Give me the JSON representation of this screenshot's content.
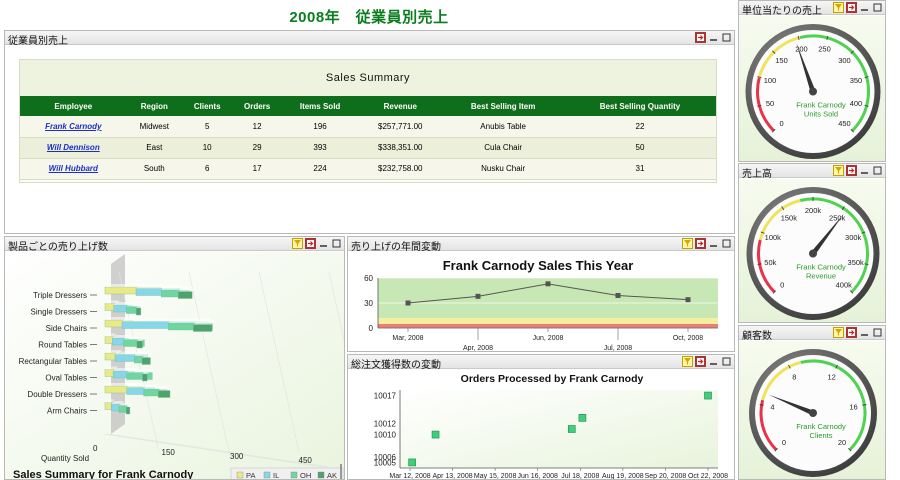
{
  "page": {
    "title": "2008年　従業員別売上"
  },
  "panels": {
    "employee_sales": {
      "title": "従業員別売上"
    },
    "product_sales": {
      "title": "製品ごとの売り上げ数"
    },
    "annual_trend": {
      "title": "売り上げの年間変動"
    },
    "orders_trend": {
      "title": "総注文獲得数の変動"
    },
    "unit_sales": {
      "title": "単位当たりの売上"
    },
    "revenue": {
      "title": "売上高"
    },
    "clients": {
      "title": "顧客数"
    }
  },
  "summary": {
    "caption": "Sales Summary",
    "columns": [
      "Employee",
      "Region",
      "Clients",
      "Orders",
      "Items Sold",
      "Revenue",
      "Best Selling Item",
      "Best Selling Quantity"
    ],
    "rows": [
      [
        "Frank Carnody",
        "Midwest",
        "5",
        "12",
        "196",
        "$257,771.00",
        "Anubis Table",
        "22"
      ],
      [
        "Will Dennison",
        "East",
        "10",
        "29",
        "393",
        "$338,351.00",
        "Cula Chair",
        "50"
      ],
      [
        "Will Hubbard",
        "South",
        "6",
        "17",
        "224",
        "$232,758.00",
        "Nusku Chair",
        "31"
      ]
    ]
  },
  "gauges": {
    "unit_sales": {
      "ticks": [
        "0",
        "50",
        "100",
        "150",
        "200",
        "250",
        "300",
        "350",
        "400",
        "450"
      ],
      "label1": "Frank Carnody",
      "label2": "Units Sold",
      "value_fraction": 0.43
    },
    "revenue": {
      "ticks": [
        "0",
        "50k",
        "100k",
        "150k",
        "200k",
        "250k",
        "300k",
        "350k",
        "400k"
      ],
      "label1": "Frank Carnody",
      "label2": "Revenue",
      "value_fraction": 0.64
    },
    "clients": {
      "ticks": [
        "0",
        "4",
        "8",
        "12",
        "16",
        "20"
      ],
      "label1": "Frank Carnody",
      "label2": "Clients",
      "value_fraction": 0.25
    }
  },
  "colors": {
    "title_green": "#0b7d1f",
    "header_green": "#0f6e1b",
    "link_blue": "#1a2ecc",
    "gauge_green": "#4fd24f",
    "gauge_yellow": "#f0e35a",
    "gauge_red": "#e8334a"
  },
  "chart_data": [
    {
      "type": "bar",
      "orientation": "horizontal",
      "title": "Sales Summary for Frank Carnody",
      "xlabel": "Quantity Sold",
      "categories": [
        "Triple Dressers",
        "Single Dressers",
        "Side Chairs",
        "Round Tables",
        "Rectangular Tables",
        "Oval Tables",
        "Double Dressers",
        "Arm Chairs"
      ],
      "x_ticks": [
        "0",
        "150",
        "300",
        "450"
      ],
      "xlim": [
        0,
        450
      ],
      "series": [
        {
          "name": "PA",
          "color": "#e9ea86",
          "values": [
            120,
            25,
            60,
            18,
            30,
            22,
            80,
            14
          ]
        },
        {
          "name": "IL",
          "color": "#86d8e8",
          "values": [
            95,
            40,
            185,
            35,
            70,
            45,
            60,
            20
          ]
        },
        {
          "name": "OH",
          "color": "#6fd6a0",
          "values": [
            60,
            30,
            95,
            45,
            20,
            55,
            50,
            18
          ]
        },
        {
          "name": "AK",
          "color": "#4ea36a",
          "values": [
            30,
            10,
            40,
            12,
            18,
            10,
            25,
            8
          ]
        }
      ]
    },
    {
      "type": "line",
      "title": "Frank Carnody Sales This Year",
      "x": [
        "Mar, 2008",
        "Apr, 2008",
        "Jun, 2008",
        "Jul, 2008",
        "Oct, 2008"
      ],
      "x_ticks": [
        "Mar, 2008",
        "Apr, 2008",
        "Jun, 2008",
        "Jul, 2008",
        "Oct, 2008"
      ],
      "values": [
        30,
        38,
        53,
        39,
        34
      ],
      "ylim": [
        0,
        60
      ],
      "y_ticks": [
        "0",
        "30",
        "60"
      ],
      "bands": [
        {
          "from": 0,
          "to": 5,
          "color": "#f07d74"
        },
        {
          "from": 5,
          "to": 12,
          "color": "#f5efa0"
        },
        {
          "from": 12,
          "to": 60,
          "color": "#c7e8b4"
        }
      ]
    },
    {
      "type": "scatter",
      "title": "Orders Processed by Frank Carnody",
      "x": [
        "Mar 12, 2008",
        "Apr 13, 2008",
        "Jul 18, 2008",
        "Jul 24, 2008",
        "Oct 22, 2008"
      ],
      "y": [
        10005,
        10010,
        10011,
        10013,
        10017
      ],
      "x_ticks": [
        "Mar 12, 2008",
        "Apr 13, 2008",
        "May 15, 2008",
        "Jun 16, 2008",
        "Jul 18, 2008",
        "Aug 19, 2008",
        "Sep 20, 2008",
        "Oct 22, 2008"
      ],
      "ylim": [
        10004,
        10018
      ],
      "y_ticks": [
        "10005",
        "10006",
        "10010",
        "10012",
        "10017"
      ]
    }
  ]
}
